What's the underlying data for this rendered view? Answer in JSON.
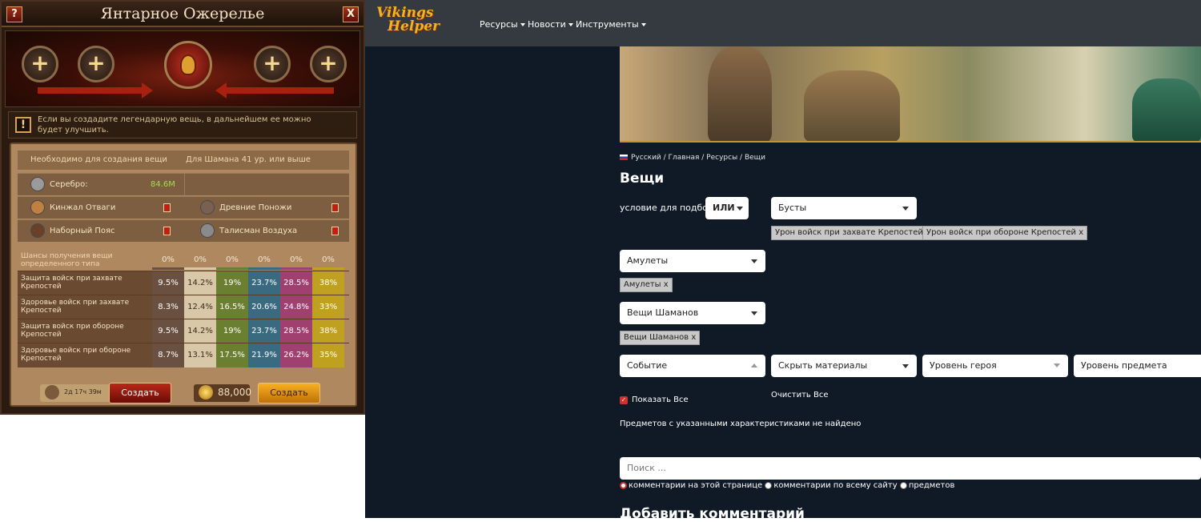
{
  "game": {
    "title": "Янтарное Ожерелье",
    "help_label": "?",
    "close_label": "X",
    "notice": "Если вы создадите легендарную вещь, в дальнейшем ее можно будет улучшить.",
    "requirements": {
      "header_left": "Необходимо для создания вещи",
      "header_right": "Для Шамана 41 ур. или выше",
      "silver_label": "Серебро:",
      "silver_value": "84.6M",
      "items": [
        "Кинжал Отваги",
        "Древние Поножи",
        "Наборный Пояс",
        "Талисман Воздуха"
      ]
    },
    "chances": {
      "label": "Шансы получения вещи определенного типа",
      "col_values": [
        "0%",
        "0%",
        "0%",
        "0%",
        "0%",
        "0%"
      ],
      "colors": [
        "#6a5040",
        "#d8c8a8",
        "#6a8030",
        "#3a6a80",
        "#a04070",
        "#c0a020"
      ],
      "rows": [
        {
          "name": "Защита войск при захвате Крепостей",
          "values": [
            "9.5%",
            "14.2%",
            "19%",
            "23.7%",
            "28.5%",
            "38%"
          ]
        },
        {
          "name": "Здоровье войск при захвате Крепостей",
          "values": [
            "8.3%",
            "12.4%",
            "16.5%",
            "20.6%",
            "24.8%",
            "33%"
          ]
        },
        {
          "name": "Защита войск при обороне Крепостей",
          "values": [
            "9.5%",
            "14.2%",
            "19%",
            "23.7%",
            "28.5%",
            "38%"
          ]
        },
        {
          "name": "Здоровье войск при обороне Крепостей",
          "values": [
            "8.7%",
            "13.1%",
            "17.5%",
            "21.9%",
            "26.2%",
            "35%"
          ]
        }
      ]
    },
    "craft": {
      "timer": "2д 17ч 39м",
      "button_label": "Создать",
      "gold_value": "88,000",
      "gold_button_label": "Создать"
    }
  },
  "site": {
    "logo_line1": "Vikings",
    "logo_line2": "Helper",
    "nav": [
      "Ресурсы",
      "Новости",
      "Инструменты"
    ],
    "breadcrumb": {
      "lang": "Русский",
      "path": " / Главная / Ресурсы / Вещи"
    },
    "page_title": "Вещи",
    "condition_label": "условие для подбора:",
    "condition_value": "ИЛИ",
    "boosts_select": "Бусты",
    "boost_tags": [
      "Урон войск при захвате Крепостей x",
      "Урон войск при обороне Крепостей x"
    ],
    "amulets_select": "Амулеты",
    "amulets_tag": "Амулеты x",
    "shaman_select": "Вещи Шаманов",
    "shaman_tag": "Вещи Шаманов x",
    "filters": {
      "event": "Событие",
      "hide_materials": "Скрыть материалы",
      "hero_level": "Уровень героя",
      "item_level": "Уровень предмета"
    },
    "show_all": "Показать Все",
    "clear_all": "Очистить Все",
    "no_results": "Предметов с указанными характеристиками не найдено",
    "search_placeholder": "Поиск ...",
    "radios": [
      "комментарии на этой странице",
      "комментарии по всему сайту",
      "предметов"
    ],
    "add_comment": "Добавить комментарий"
  }
}
